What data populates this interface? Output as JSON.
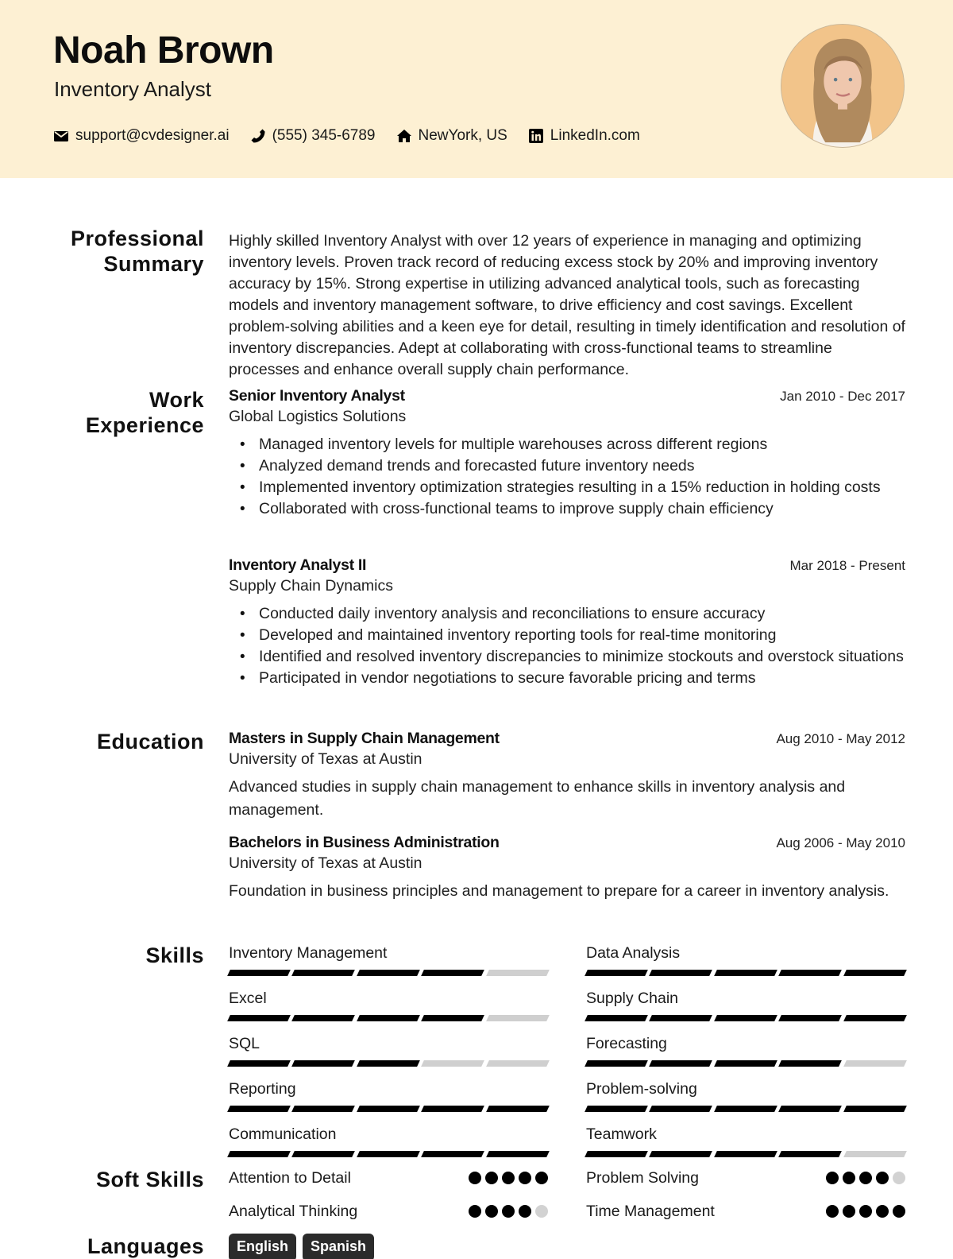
{
  "header": {
    "name": "Noah Brown",
    "title": "Inventory Analyst",
    "contacts": [
      {
        "icon": "envelope-icon",
        "text": "support@cvdesigner.ai"
      },
      {
        "icon": "phone-icon",
        "text": "(555) 345-6789"
      },
      {
        "icon": "home-icon",
        "text": "NewYork, US"
      },
      {
        "icon": "linkedin-icon",
        "text": "LinkedIn.com"
      }
    ],
    "colors": {
      "background": "#fdf0d3",
      "photo_background": "#f2c48a"
    }
  },
  "sections": {
    "summary": {
      "title_line1": "Professional",
      "title_line2": "Summary",
      "text": "Highly skilled Inventory Analyst with over 12 years of experience in managing and optimizing inventory levels. Proven track record of reducing excess stock by 20% and improving inventory accuracy by 15%. Strong expertise in utilizing advanced analytical tools, such as forecasting models and inventory management software, to drive efficiency and cost savings. Excellent problem-solving abilities and a keen eye for detail, resulting in timely identification and resolution of inventory discrepancies. Adept at collaborating with cross-functional teams to streamline processes and enhance overall supply chain performance."
    },
    "work": {
      "title_line1": "Work",
      "title_line2": "Experience",
      "jobs": [
        {
          "title": "Senior Inventory Analyst",
          "company": "Global Logistics Solutions",
          "dates": "Jan 2010 - Dec 2017",
          "bullets": [
            "Managed inventory levels for multiple warehouses across different regions",
            "Analyzed demand trends and forecasted future inventory needs",
            "Implemented inventory optimization strategies resulting in a 15% reduction in holding costs",
            "Collaborated with cross-functional teams to improve supply chain efficiency"
          ]
        },
        {
          "title": "Inventory Analyst II",
          "company": "Supply Chain Dynamics",
          "dates": "Mar 2018 - Present",
          "bullets": [
            "Conducted daily inventory analysis and reconciliations to ensure accuracy",
            "Developed and maintained inventory reporting tools for real-time monitoring",
            "Identified and resolved inventory discrepancies to minimize stockouts and overstock situations",
            "Participated in vendor negotiations to secure favorable pricing and terms"
          ]
        }
      ]
    },
    "education": {
      "title": "Education",
      "items": [
        {
          "degree": "Masters in Supply Chain Management",
          "school": "University of Texas at Austin",
          "dates": "Aug 2010 - May 2012",
          "description": "Advanced studies in supply chain management to enhance skills in inventory analysis and management."
        },
        {
          "degree": "Bachelors in Business Administration",
          "school": "University of Texas at Austin",
          "dates": "Aug 2006 - May 2010",
          "description": "Foundation in business principles and management to prepare for a career in inventory analysis."
        }
      ]
    },
    "skills": {
      "title": "Skills",
      "max_level": 5,
      "items": [
        {
          "name": "Inventory Management",
          "level": 4
        },
        {
          "name": "Data Analysis",
          "level": 5
        },
        {
          "name": "Excel",
          "level": 4
        },
        {
          "name": "Supply Chain",
          "level": 5
        },
        {
          "name": "SQL",
          "level": 3
        },
        {
          "name": "Forecasting",
          "level": 4
        },
        {
          "name": "Reporting",
          "level": 5
        },
        {
          "name": "Problem-solving",
          "level": 5
        },
        {
          "name": "Communication",
          "level": 5
        },
        {
          "name": "Teamwork",
          "level": 4
        }
      ]
    },
    "soft_skills": {
      "title": "Soft Skills",
      "max_level": 5,
      "items": [
        {
          "name": "Attention to Detail",
          "level": 5
        },
        {
          "name": "Problem Solving",
          "level": 4
        },
        {
          "name": "Analytical Thinking",
          "level": 4
        },
        {
          "name": "Time Management",
          "level": 5
        }
      ]
    },
    "languages": {
      "title": "Languages",
      "items": [
        "English",
        "Spanish"
      ]
    }
  }
}
